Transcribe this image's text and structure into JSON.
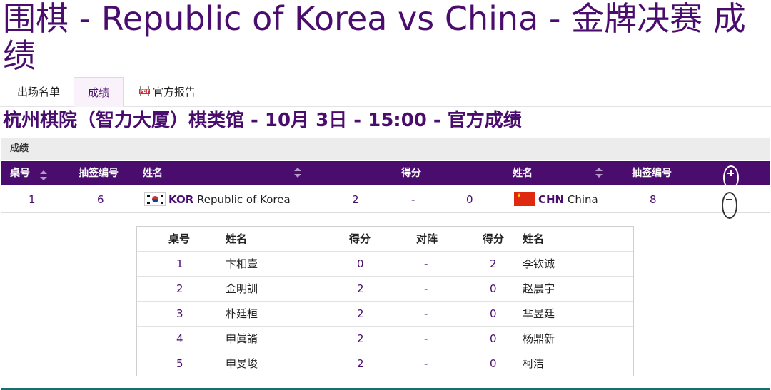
{
  "page": {
    "title": "围棋 - Republic of Korea vs China - 金牌决赛 成绩",
    "subtitle": "杭州棋院（智力大厦）棋类馆 - 10月 3日 - 15:00 - 官方成绩"
  },
  "tabs": [
    {
      "label": "出场名单",
      "active": false
    },
    {
      "label": "成绩",
      "active": true
    },
    {
      "label": "官方报告",
      "icon": "pdf-icon",
      "active": false
    }
  ],
  "section": {
    "label": "成绩"
  },
  "results_header": {
    "table_no": "桌号",
    "draw_no_left": "抽签编号",
    "name_left": "姓名",
    "score": "得分",
    "name_right": "姓名",
    "draw_no_right": "抽签编号",
    "expand_icon": "plus-circle-icon"
  },
  "match": {
    "table_no": "1",
    "draw_no_left": "6",
    "left_noc": "KOR",
    "left_name": "Republic of Korea",
    "left_score": "2",
    "separator": "-",
    "right_score": "0",
    "right_noc": "CHN",
    "right_name": "China",
    "draw_no_right": "8",
    "collapse_icon": "minus-circle-icon"
  },
  "detail_header": {
    "table_no": "桌号",
    "name_left": "姓名",
    "score_left": "得分",
    "vs": "对阵",
    "score_right": "得分",
    "name_right": "姓名"
  },
  "boards": [
    {
      "no": "1",
      "left": "卞相壹",
      "ls": "0",
      "sep": "-",
      "rs": "2",
      "right": "李钦诚"
    },
    {
      "no": "2",
      "left": "金明訓",
      "ls": "2",
      "sep": "-",
      "rs": "0",
      "right": "赵晨宇"
    },
    {
      "no": "3",
      "left": "朴廷桓",
      "ls": "2",
      "sep": "-",
      "rs": "0",
      "right": "芈昱廷"
    },
    {
      "no": "4",
      "left": "申眞諝",
      "ls": "2",
      "sep": "-",
      "rs": "0",
      "right": "杨鼎新"
    },
    {
      "no": "5",
      "left": "申旻埈",
      "ls": "2",
      "sep": "-",
      "rs": "0",
      "right": "柯洁"
    }
  ],
  "colors": {
    "accent": "#4a0d6e",
    "header_bg": "#4a0d6e",
    "section_bg": "#ececec",
    "footer_line": "#1b6e6e"
  }
}
